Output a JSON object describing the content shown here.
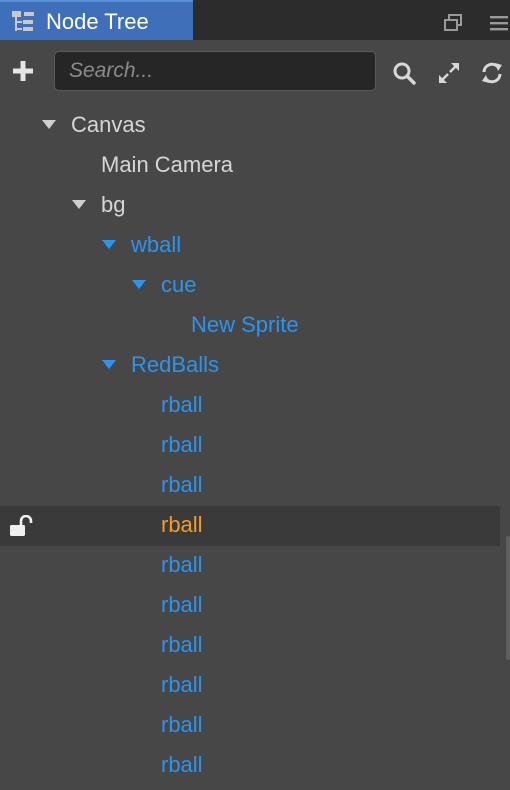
{
  "panel": {
    "tab_title": "Node Tree",
    "tab_icon": "node-tree-icon"
  },
  "toolbar": {
    "add_icon": "plus-icon",
    "search_placeholder": "Search...",
    "search_value": "",
    "icons": [
      "search-icon",
      "expand-icon",
      "refresh-icon"
    ]
  },
  "tree": {
    "nodes": [
      {
        "label": "Canvas",
        "depth": 0,
        "expanded": true,
        "color": "white"
      },
      {
        "label": "Main Camera",
        "depth": 1,
        "expanded": null,
        "color": "white"
      },
      {
        "label": "bg",
        "depth": 1,
        "expanded": true,
        "color": "white"
      },
      {
        "label": "wball",
        "depth": 2,
        "expanded": true,
        "color": "blue"
      },
      {
        "label": "cue",
        "depth": 3,
        "expanded": true,
        "color": "blue"
      },
      {
        "label": "New Sprite",
        "depth": 4,
        "expanded": null,
        "color": "blue"
      },
      {
        "label": "RedBalls",
        "depth": 2,
        "expanded": true,
        "color": "blue"
      },
      {
        "label": "rball",
        "depth": 3,
        "expanded": null,
        "color": "blue"
      },
      {
        "label": "rball",
        "depth": 3,
        "expanded": null,
        "color": "blue"
      },
      {
        "label": "rball",
        "depth": 3,
        "expanded": null,
        "color": "blue"
      },
      {
        "label": "rball",
        "depth": 3,
        "expanded": null,
        "color": "orange",
        "selected": true,
        "lock_icon": "unlock-icon"
      },
      {
        "label": "rball",
        "depth": 3,
        "expanded": null,
        "color": "blue"
      },
      {
        "label": "rball",
        "depth": 3,
        "expanded": null,
        "color": "blue"
      },
      {
        "label": "rball",
        "depth": 3,
        "expanded": null,
        "color": "blue"
      },
      {
        "label": "rball",
        "depth": 3,
        "expanded": null,
        "color": "blue"
      },
      {
        "label": "rball",
        "depth": 3,
        "expanded": null,
        "color": "blue"
      },
      {
        "label": "rball",
        "depth": 3,
        "expanded": null,
        "color": "blue"
      }
    ]
  },
  "colors": {
    "background": "#474747",
    "tab_active": "#3e6fb8",
    "prefab_blue": "#2b94f0",
    "selected_orange": "#f39c2a",
    "text_default": "#d6d6d6"
  }
}
